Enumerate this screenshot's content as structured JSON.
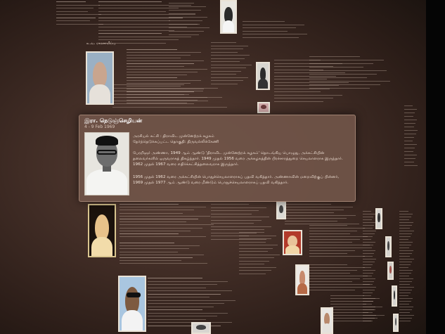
{
  "card": {
    "name": "இரா. நெடுஞ்செழியன்",
    "dates": "4 - 9 Feb 1969",
    "party_line": "அரசியல் கட்சி : திராவிட முன்னேற்றக் கழகம்",
    "constituency_line": "தேர்ந்தெடுக்கப்பட்ட தொகுதி: திருவல்லிக்கேணி",
    "bio_paragraph_1": "பேரறிஞர் அண்ணா, 1949 ஆம் ஆண்டு 'திராவிட முன்னேற்றக் கழகம்' தொடங்கிய பொழுது, அக்கட்சியின் தலைவர்களில் ஒருவராகத் திகழ்ந்தார். 1949 முதல் 1956 வரை அக்கழகத்தின் பிரச்சாரத்துறை செயலாளராக இருந்தார். 1962 முதல் 1967 வரை எதிர்க்கட்சித்தலைவராக இருந்தார்.",
    "bio_paragraph_2": "1956 முதல் 1962 வரை அக்கட்சியின் பொதுச்செயலாளராகப் பதவி வகித்தார். அண்ணாவின் மறைவிற்குப் பின்னர், 1969 முதல் 1977 ஆம் ஆண்டு வரை மீண்டும் பொதுச்செயலாளராகப் பதவி வகித்தார்."
  },
  "background_entries": {
    "entry_top_name": "உ.வ. ராமசாமிப்பு"
  }
}
